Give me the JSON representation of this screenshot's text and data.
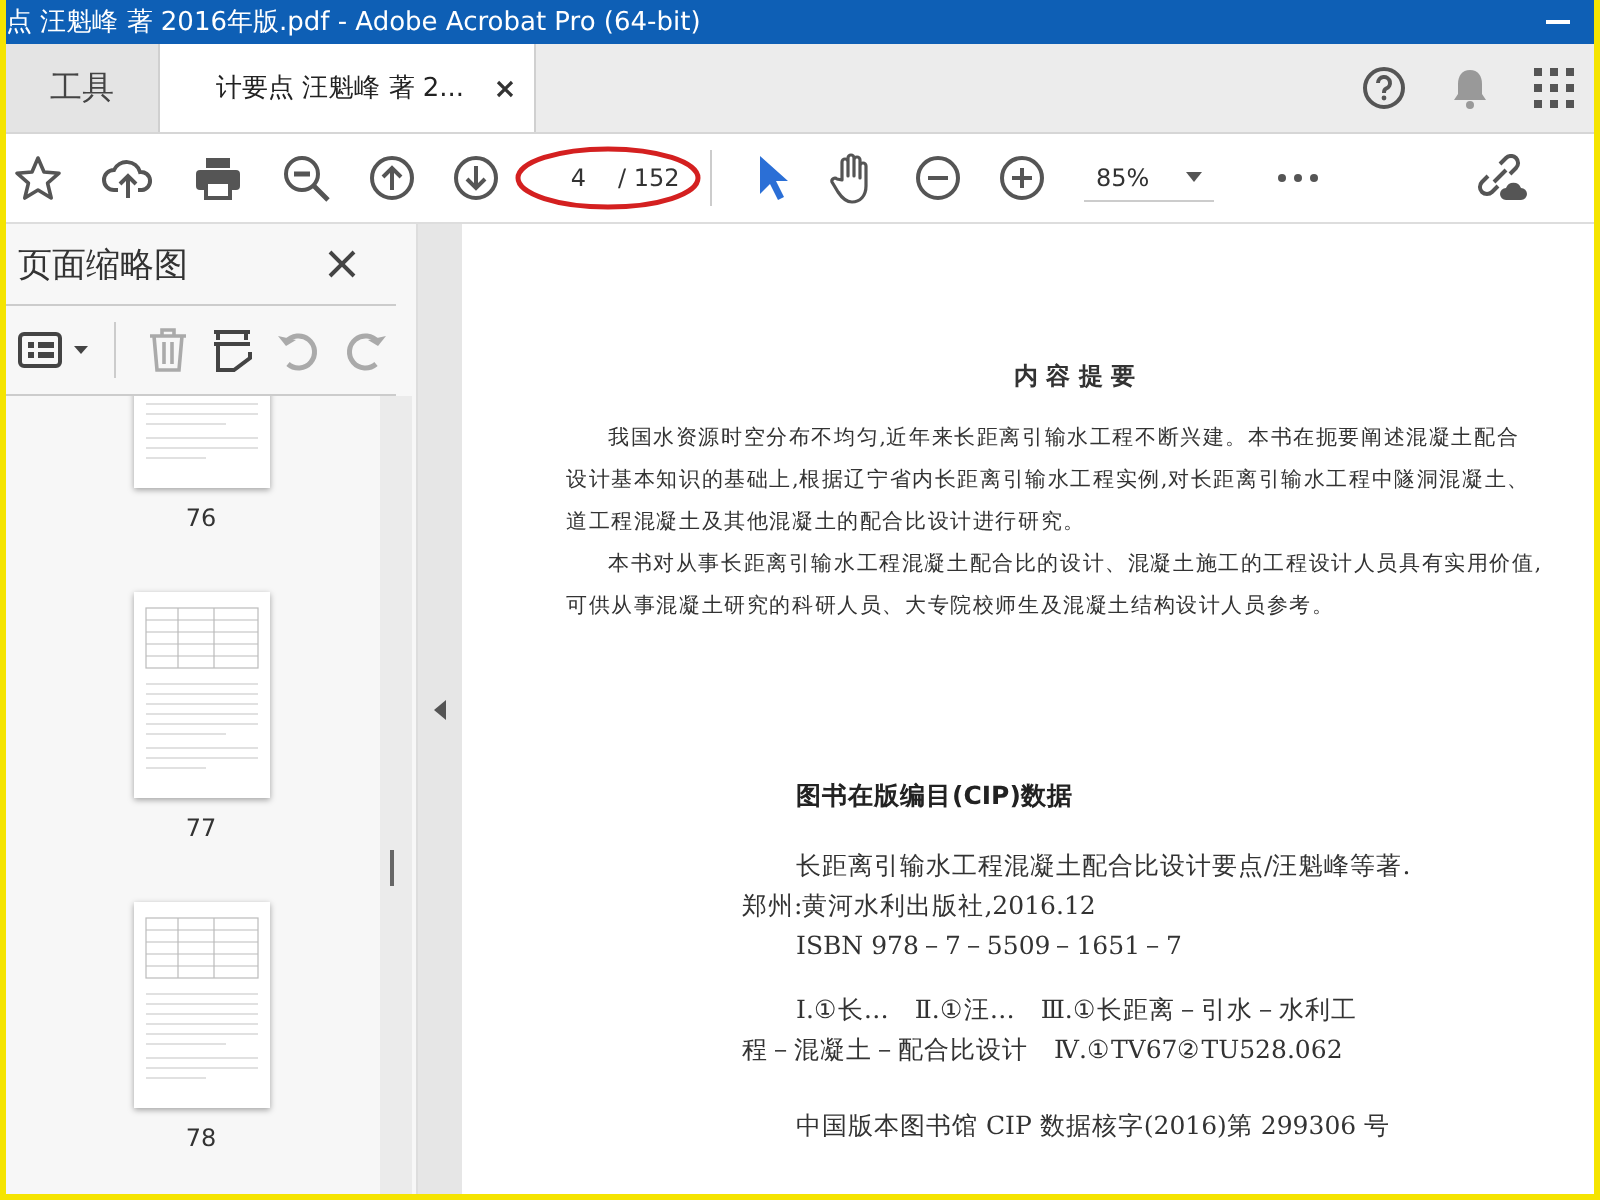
{
  "window": {
    "title": "点 汪魁峰 著 2016年版.pdf - Adobe Acrobat Pro (64-bit)"
  },
  "tabs": [
    {
      "label": "工具",
      "selected": false
    },
    {
      "label": "计要点 汪魁峰 著 2...",
      "selected": true
    }
  ],
  "toolbar": {
    "page": "4",
    "page_total": "/ 152",
    "zoom": "85%"
  },
  "thumbnail_panel": {
    "title": "页面缩略图",
    "thumbnails": [
      {
        "label": "76",
        "kind": "text"
      },
      {
        "label": "77",
        "kind": "table"
      },
      {
        "label": "78",
        "kind": "table"
      }
    ]
  },
  "document": {
    "heading": "内 容 提 要",
    "summary_lines": [
      {
        "text": "我国水资源时空分布不均匀,近年来长距离引输水工程不断兴建。本书在扼要阐述混凝土配合",
        "indent": true
      },
      {
        "text": "设计基本知识的基础上,根据辽宁省内长距离引输水工程实例,对长距离引输水工程中隧洞混凝土、",
        "indent": false
      },
      {
        "text": "道工程混凝土及其他混凝土的配合比设计进行研究。",
        "indent": false
      },
      {
        "text": "本书对从事长距离引输水工程混凝土配合比的设计、混凝土施工的工程设计人员具有实用价值,",
        "indent": true
      },
      {
        "text": "可供从事混凝土研究的科研人员、大专院校师生及混凝土结构设计人员参考。",
        "indent": false
      }
    ],
    "cip_heading": "图书在版编目(CIP)数据",
    "cip_paragraphs": [
      [
        {
          "text": "长距离引输水工程混凝土配合比设计要点/汪魁峰等著.",
          "indent": true
        },
        {
          "text": "郑州:黄河水利出版社,2016.12",
          "indent": false
        },
        {
          "text": "ISBN 978－7－5509－1651－7",
          "indent": true
        }
      ],
      [
        {
          "text": "Ⅰ.①长…　Ⅱ.①汪…　Ⅲ.①长距离－引水－水利工",
          "indent": true
        },
        {
          "text": "程－混凝土－配合比设计　Ⅳ.①TV67②TU528.062",
          "indent": false
        }
      ]
    ],
    "cip_number": "中国版本图书馆 CIP 数据核字(2016)第 299306 号"
  }
}
